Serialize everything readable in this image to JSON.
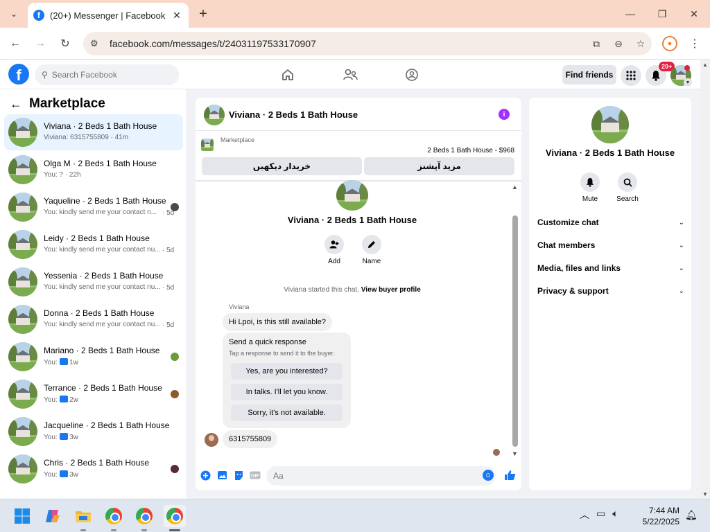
{
  "browser": {
    "tab_title": "(20+) Messenger | Facebook",
    "url": "facebook.com/messages/t/24031197533170907"
  },
  "fb_header": {
    "search_placeholder": "Search Facebook",
    "find_friends": "Find friends",
    "notification_count": "20+"
  },
  "sidebar": {
    "title": "Marketplace",
    "conversations": [
      {
        "name": "Viviana · 2 Beds 1 Bath House",
        "snippet": "Viviana: 6315755809 · 41m",
        "time": "",
        "active": true
      },
      {
        "name": "Olga M · 2 Beds 1 Bath House",
        "snippet": "You: ? · 22h",
        "time": ""
      },
      {
        "name": "Yaqueline · 2 Beds 1 Bath House",
        "snippet": "You: kindly send me your contact n...",
        "time": "· 5d",
        "read_color": "#4a4a4a"
      },
      {
        "name": "Leidy · 2 Beds 1 Bath House",
        "snippet": "You: kindly send me your contact nu...",
        "time": "· 5d"
      },
      {
        "name": "Yessenia · 2 Beds 1 Bath House",
        "snippet": "You: kindly send me your contact nu...",
        "time": "· 5d"
      },
      {
        "name": "Donna · 2 Beds 1 Bath House",
        "snippet": "You: kindly send me your contact nu...",
        "time": "· 5d"
      },
      {
        "name": "Mariano · 2 Beds 1 Bath House",
        "snippet": "You:",
        "time": "· 1w",
        "read_color": "#6a9a3a",
        "like": true
      },
      {
        "name": "Terrance · 2 Beds 1 Bath House",
        "snippet": "You:",
        "time": "· 2w",
        "read_color": "#8a5a2a",
        "like": true
      },
      {
        "name": "Jacqueline · 2 Beds 1 Bath House",
        "snippet": "You:",
        "time": "· 3w",
        "like": true
      },
      {
        "name": "Chris · 2 Beds 1 Bath House",
        "snippet": "You:",
        "time": "· 3w",
        "read_color": "#5a2a3a",
        "like": true
      }
    ]
  },
  "chat": {
    "header_name": "Viviana · 2 Beds 1 Bath House",
    "marketplace_label": "Marketplace",
    "listing": "2 Beds 1 Bath House - $968",
    "btn_view_buyers": "خریدار دیکھیں",
    "btn_more_options": "مزید آپشنز",
    "intro_name": "Viviana · 2 Beds 1 Bath House",
    "add_label": "Add",
    "name_label": "Name",
    "started_text": "Viviana started this chat.",
    "view_buyer_profile": "View buyer profile",
    "sender": "Viviana",
    "message1": "Hi Lpoi, is this still available?",
    "quick_title": "Send a quick response",
    "quick_sub": "Tap a response to send it to the buyer.",
    "quick_options": [
      "Yes, are you interested?",
      "In talks. I'll let you know.",
      "Sorry, it's not available."
    ],
    "message2": "6315755809",
    "composer_placeholder": "Aa"
  },
  "info_panel": {
    "name": "Viviana · 2 Beds 1 Bath House",
    "mute": "Mute",
    "search": "Search",
    "sections": [
      "Customize chat",
      "Chat members",
      "Media, files and links",
      "Privacy & support"
    ]
  },
  "taskbar": {
    "time": "7:44 AM",
    "date": "5/22/2025"
  },
  "colors": {
    "fb_blue": "#1877f2",
    "info_purple": "#a033ff",
    "tab_bar": "#f9d8c8",
    "badge_red": "#e41e3f"
  }
}
